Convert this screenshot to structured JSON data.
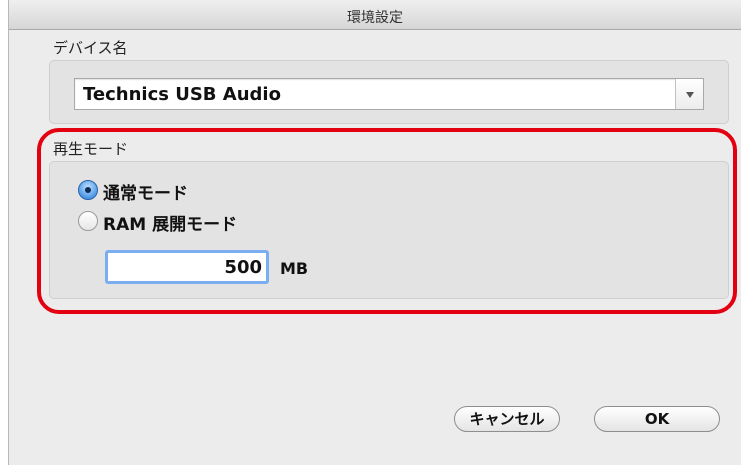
{
  "window": {
    "title": "環境設定"
  },
  "device": {
    "label": "デバイス名",
    "selected": "Technics USB Audio"
  },
  "playback": {
    "label": "再生モード",
    "options": [
      {
        "label": "通常モード",
        "selected": true
      },
      {
        "label": "RAM 展開モード",
        "selected": false
      }
    ],
    "ram_size": "500",
    "ram_unit": "MB"
  },
  "buttons": {
    "cancel": "キャンセル",
    "ok": "OK"
  },
  "colors": {
    "highlight": "#e30011",
    "focus_ring": "#7aaef0"
  }
}
